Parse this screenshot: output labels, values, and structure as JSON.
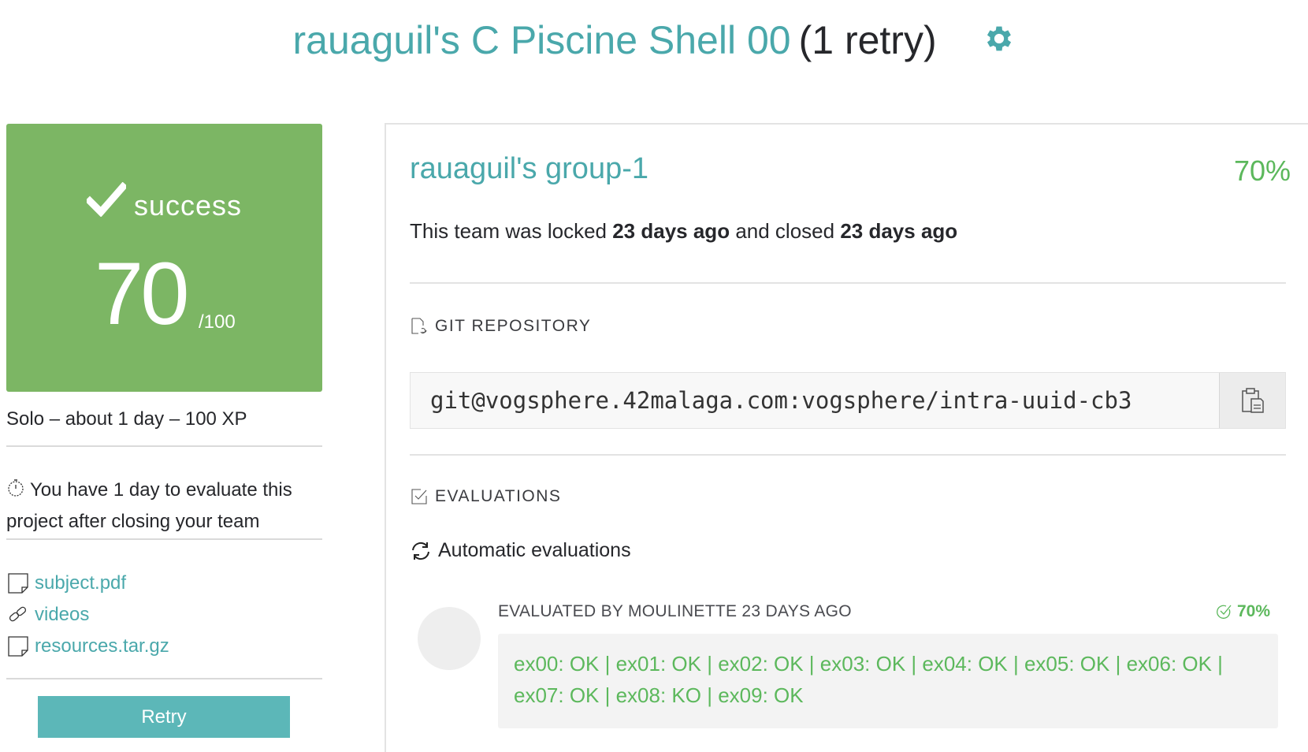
{
  "header": {
    "title": "rauaguil's C Piscine Shell 00",
    "retry_count": "(1 retry)",
    "settings_icon": "gear-icon"
  },
  "status_card": {
    "status": "success",
    "score": "70",
    "score_max": "/100",
    "background_color": "#7cb664"
  },
  "project_meta": "Solo – about 1 day – 100 XP",
  "evaluation_note": "You have 1 day to evaluate this project after closing your team",
  "attachments": [
    {
      "label": "subject.pdf",
      "icon": "document-icon"
    },
    {
      "label": "videos",
      "icon": "link-icon"
    },
    {
      "label": "resources.tar.gz",
      "icon": "document-icon"
    }
  ],
  "retry_button": "Retry",
  "team": {
    "name": "rauaguil's group-1",
    "percentage": "70%",
    "lock_prefix": "This team was locked",
    "locked_ago": "23 days ago",
    "lock_middle": "and closed",
    "closed_ago": "23 days ago"
  },
  "git_repository": {
    "label": "GIT REPOSITORY",
    "url": "git@vogsphere.42malaga.com:vogsphere/intra-uuid-cb3",
    "copy_icon": "clipboard-icon"
  },
  "evaluations": {
    "label": "EVALUATIONS",
    "automatic_label": "Automatic evaluations",
    "evaluator": "EVALUATED BY MOULINETTE 23 DAYS AGO",
    "score": "70%",
    "result": "ex00: OK | ex01: OK | ex02: OK | ex03: OK | ex04: OK | ex05: OK | ex06: OK | ex07: OK | ex08: KO | ex09: OK"
  },
  "colors": {
    "accent_teal": "#4aa8ab",
    "success_green": "#5cb85c",
    "button_teal": "#5cb7b8"
  }
}
